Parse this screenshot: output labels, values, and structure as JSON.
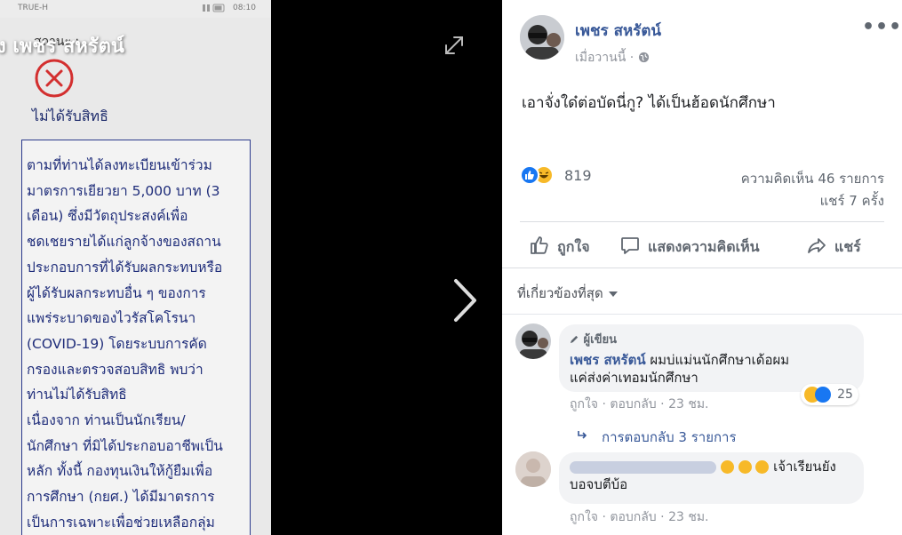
{
  "phone": {
    "carrier": "TRUE-H",
    "time": "08:10",
    "overlay_name": "ง เพชร สหรัตน์",
    "status_label": "สถานะ :",
    "rejected_text": "ไม่ได้รับสิทธิ",
    "notice_lines": [
      "ตามที่ท่านได้ลงทะเบียนเข้าร่วม",
      "มาตรการเยียวยา 5,000 บาท (3",
      "เดือน) ซึ่งมีวัตถุประสงค์เพื่อ",
      "ชดเชยรายได้แก่ลูกจ้างของสถาน",
      "ประกอบการที่ได้รับผลกระทบหรือ",
      "ผู้ได้รับผลกระทบอื่น ๆ ของการ",
      "แพร่ระบาดของไวรัสโคโรนา",
      "(COVID-19) โดยระบบการคัด",
      "กรองและตรวจสอบสิทธิ พบว่า",
      "ท่านไม่ได้รับสิทธิ",
      "เนื่องจาก ท่านเป็นนักเรียน/",
      "นักศึกษา ที่มิได้ประกอบอาชีพเป็น",
      "หลัก ทั้งนี้ กองทุนเงินให้กู้ยืมเพื่อ",
      "การศึกษา (กยศ.) ได้มีมาตรการ",
      "เป็นการเฉพาะเพื่อช่วยเหลือกลุ่ม"
    ]
  },
  "post": {
    "author": "เพชร สหรัตน์",
    "time": "เมื่อวานนี้",
    "separator": "·",
    "more_icon": "more-dots-icon",
    "text": "เอาจั่งใด๋ต่อบัดนี่กู? ได้เป็นฮ้อดนักศึกษา",
    "reactions_count": "819",
    "comments_count": "ความคิดเห็น 46 รายการ",
    "shares_count": "แชร์ 7 ครั้ง",
    "actions": {
      "like": "ถูกใจ",
      "comment": "แสดงความคิดเห็น",
      "share": "แชร์"
    },
    "sort_label": "ที่เกี่ยวข้องที่สุด"
  },
  "comments": [
    {
      "badge": "ผู้เขียน",
      "author": "เพชร สหรัตน์",
      "text_line1": "ผมบ่แม่นนักศึกษาเด้อผม",
      "text_line2": "แค่ส่งค่าเทอมนักศึกษา",
      "reactions": "25",
      "like": "ถูกใจ",
      "reply": "ตอบกลับ",
      "time": "23 ชม.",
      "replies_link": "การตอบกลับ 3 รายการ"
    },
    {
      "text_line1": "เจ้าเรียนยัง",
      "text_line2": "บอจบตีบ้อ",
      "like": "ถูกใจ",
      "reply": "ตอบกลับ",
      "time": "23 ชม."
    }
  ],
  "colors": {
    "link": "#385898",
    "secondary": "#606770",
    "like_blue": "#1877f2",
    "haha_yellow": "#f7b928",
    "notice_text": "#1f2d7a",
    "rejected_red": "#d32f2f"
  }
}
